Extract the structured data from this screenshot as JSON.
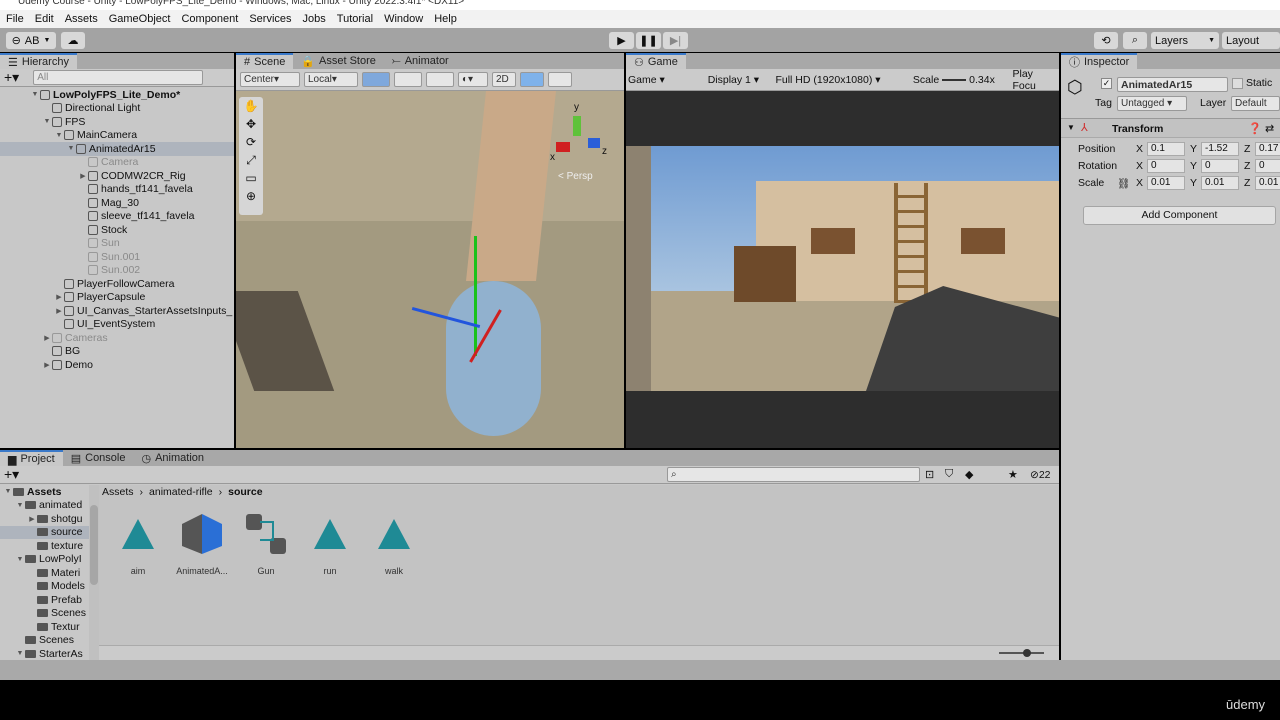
{
  "window": {
    "title": "Udemy Course - Unity - LowPolyFPS_Lite_Demo - Windows, Mac, Linux - Unity 2022.3.4f1* <DX11>"
  },
  "menu": [
    "File",
    "Edit",
    "Assets",
    "GameObject",
    "Component",
    "Services",
    "Jobs",
    "Tutorial",
    "Window",
    "Help"
  ],
  "toolbar": {
    "account": "AB",
    "layers": "Layers",
    "layout": "Layout"
  },
  "hierarchy": {
    "tab": "Hierarchy",
    "search_placeholder": "All",
    "items": [
      {
        "label": "LowPolyFPS_Lite_Demo*",
        "depth": 0,
        "arrow": "▼",
        "scene": true
      },
      {
        "label": "Directional Light",
        "depth": 1,
        "arrow": ""
      },
      {
        "label": "FPS",
        "depth": 1,
        "arrow": "▼"
      },
      {
        "label": "MainCamera",
        "depth": 2,
        "arrow": "▼"
      },
      {
        "label": "AnimatedAr15",
        "depth": 3,
        "arrow": "▼",
        "selected": true
      },
      {
        "label": "Camera",
        "depth": 4,
        "arrow": "",
        "dim": true
      },
      {
        "label": "CODMW2CR_Rig",
        "depth": 4,
        "arrow": "▶"
      },
      {
        "label": "hands_tf141_favela",
        "depth": 4,
        "arrow": ""
      },
      {
        "label": "Mag_30",
        "depth": 4,
        "arrow": ""
      },
      {
        "label": "sleeve_tf141_favela",
        "depth": 4,
        "arrow": ""
      },
      {
        "label": "Stock",
        "depth": 4,
        "arrow": ""
      },
      {
        "label": "Sun",
        "depth": 4,
        "arrow": "",
        "dim": true
      },
      {
        "label": "Sun.001",
        "depth": 4,
        "arrow": "",
        "dim": true
      },
      {
        "label": "Sun.002",
        "depth": 4,
        "arrow": "",
        "dim": true
      },
      {
        "label": "PlayerFollowCamera",
        "depth": 2,
        "arrow": ""
      },
      {
        "label": "PlayerCapsule",
        "depth": 2,
        "arrow": "▶"
      },
      {
        "label": "UI_Canvas_StarterAssetsInputs_",
        "depth": 2,
        "arrow": "▶"
      },
      {
        "label": "UI_EventSystem",
        "depth": 2,
        "arrow": ""
      },
      {
        "label": "Cameras",
        "depth": 1,
        "arrow": "▶",
        "dim": true
      },
      {
        "label": "BG",
        "depth": 1,
        "arrow": ""
      },
      {
        "label": "Demo",
        "depth": 1,
        "arrow": "▶"
      }
    ]
  },
  "scene": {
    "tabs": [
      "Scene",
      "Asset Store",
      "Animator"
    ],
    "pivot": "Center",
    "space": "Local",
    "mode_2d": "2D",
    "persp": "< Persp",
    "gizmo_axes": {
      "x": "x",
      "y": "y",
      "z": "z"
    }
  },
  "game": {
    "tab": "Game",
    "view": "Game",
    "display": "Display 1",
    "resolution": "Full HD (1920x1080)",
    "scale_label": "Scale",
    "scale": "0.34x",
    "play_focus": "Play Focu"
  },
  "inspector": {
    "tab": "Inspector",
    "object_name": "AnimatedAr15",
    "active": true,
    "static_label": "Static",
    "tag_label": "Tag",
    "tag": "Untagged",
    "layer_label": "Layer",
    "layer": "Default",
    "transform": {
      "title": "Transform",
      "rows": [
        {
          "label": "Position",
          "x": "0.1",
          "y": "-1.52",
          "z": "0.17"
        },
        {
          "label": "Rotation",
          "x": "0",
          "y": "0",
          "z": "0"
        },
        {
          "label": "Scale",
          "x": "0.01",
          "y": "0.01",
          "z": "0.01"
        }
      ]
    },
    "add_component": "Add Component"
  },
  "project": {
    "tabs": [
      "Project",
      "Console",
      "Animation"
    ],
    "hidden_count": "22",
    "tree": [
      {
        "label": "Assets",
        "depth": 0,
        "arrow": "▼",
        "bold": true
      },
      {
        "label": "animated",
        "depth": 1,
        "arrow": "▼"
      },
      {
        "label": "shotgu",
        "depth": 2,
        "arrow": "▶"
      },
      {
        "label": "source",
        "depth": 2,
        "arrow": "",
        "selected": true
      },
      {
        "label": "texture",
        "depth": 2,
        "arrow": ""
      },
      {
        "label": "LowPolyI",
        "depth": 1,
        "arrow": "▼"
      },
      {
        "label": "Materi",
        "depth": 2,
        "arrow": ""
      },
      {
        "label": "Models",
        "depth": 2,
        "arrow": ""
      },
      {
        "label": "Prefab",
        "depth": 2,
        "arrow": ""
      },
      {
        "label": "Scenes",
        "depth": 2,
        "arrow": ""
      },
      {
        "label": "Textur",
        "depth": 2,
        "arrow": ""
      },
      {
        "label": "Scenes",
        "depth": 1,
        "arrow": ""
      },
      {
        "label": "StarterAs",
        "depth": 1,
        "arrow": "▼"
      }
    ],
    "breadcrumb": [
      "Assets",
      "animated-rifle",
      "source"
    ],
    "assets": [
      {
        "name": "aim",
        "type": "animation-clip-icon"
      },
      {
        "name": "AnimatedA...",
        "type": "prefab-model-icon"
      },
      {
        "name": "Gun",
        "type": "animator-controller-icon"
      },
      {
        "name": "run",
        "type": "animation-clip-icon"
      },
      {
        "name": "walk",
        "type": "animation-clip-icon"
      }
    ]
  },
  "colors": {
    "accent": "#3a79c9",
    "clip": "#1f8a95",
    "selection": "#aeb4bd"
  },
  "footer": {
    "brand": "ūdemy"
  }
}
